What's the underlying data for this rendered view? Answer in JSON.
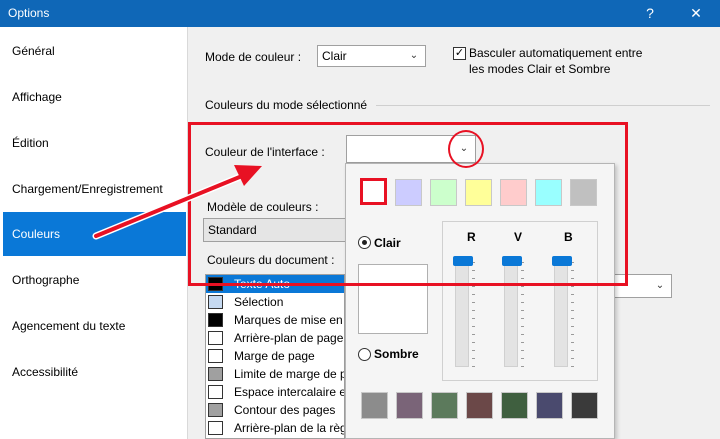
{
  "window": {
    "title": "Options",
    "help_label": "?",
    "close_label": "✕"
  },
  "sidebar": {
    "items": [
      {
        "label": "Général"
      },
      {
        "label": "Affichage"
      },
      {
        "label": "Édition"
      },
      {
        "label": "Chargement/Enregistrement"
      },
      {
        "label": "Couleurs",
        "active": true
      },
      {
        "label": "Orthographe"
      },
      {
        "label": "Agencement du texte"
      },
      {
        "label": "Accessibilité"
      }
    ]
  },
  "main": {
    "color_mode_label": "Mode de couleur :",
    "color_mode_value": "Clair",
    "auto_switch_label_line1": "Basculer automatiquement entre",
    "auto_switch_label_line2": "les modes Clair et Sombre",
    "auto_switch_checked": true,
    "selected_mode_colors_heading": "Couleurs du mode sélectionné",
    "interface_color_label": "Couleur de l'interface :",
    "color_model_label": "Modèle de couleurs :",
    "color_model_value": "Standard",
    "document_colors_label": "Couleurs du document :",
    "document_colors": [
      {
        "label": "Texte Auto",
        "color": "#000000",
        "selected": true
      },
      {
        "label": "Sélection",
        "color": "#c5d9f1"
      },
      {
        "label": "Marques de mise en f",
        "color": "#000000"
      },
      {
        "label": "Arrière-plan de page",
        "color": "#ffffff"
      },
      {
        "label": "Marge de page",
        "color": "#ffffff"
      },
      {
        "label": "Limite de marge de p",
        "color": "#a0a0a0"
      },
      {
        "label": "Espace intercalaire en",
        "color": "#ffffff"
      },
      {
        "label": "Contour des pages",
        "color": "#a0a0a0"
      },
      {
        "label": "Arrière-plan de la règ",
        "color": "#ffffff"
      }
    ]
  },
  "color_popup": {
    "top_swatches": [
      "#ffffff",
      "#ccccff",
      "#ccffcc",
      "#ffff99",
      "#ffcccc",
      "#99ffff",
      "#c0c0c0"
    ],
    "light_label": "Clair",
    "dark_label": "Sombre",
    "light_selected": true,
    "sliders": {
      "r_label": "R",
      "v_label": "V",
      "b_label": "B"
    },
    "bottom_swatches": [
      "#8c8c8c",
      "#7a6478",
      "#5c7a5c",
      "#6b4848",
      "#3f5f3f",
      "#4a4a6e",
      "#3a3a3a"
    ]
  },
  "annotation_colors": {
    "highlight": "#e81123",
    "accent": "#0a78d7"
  }
}
